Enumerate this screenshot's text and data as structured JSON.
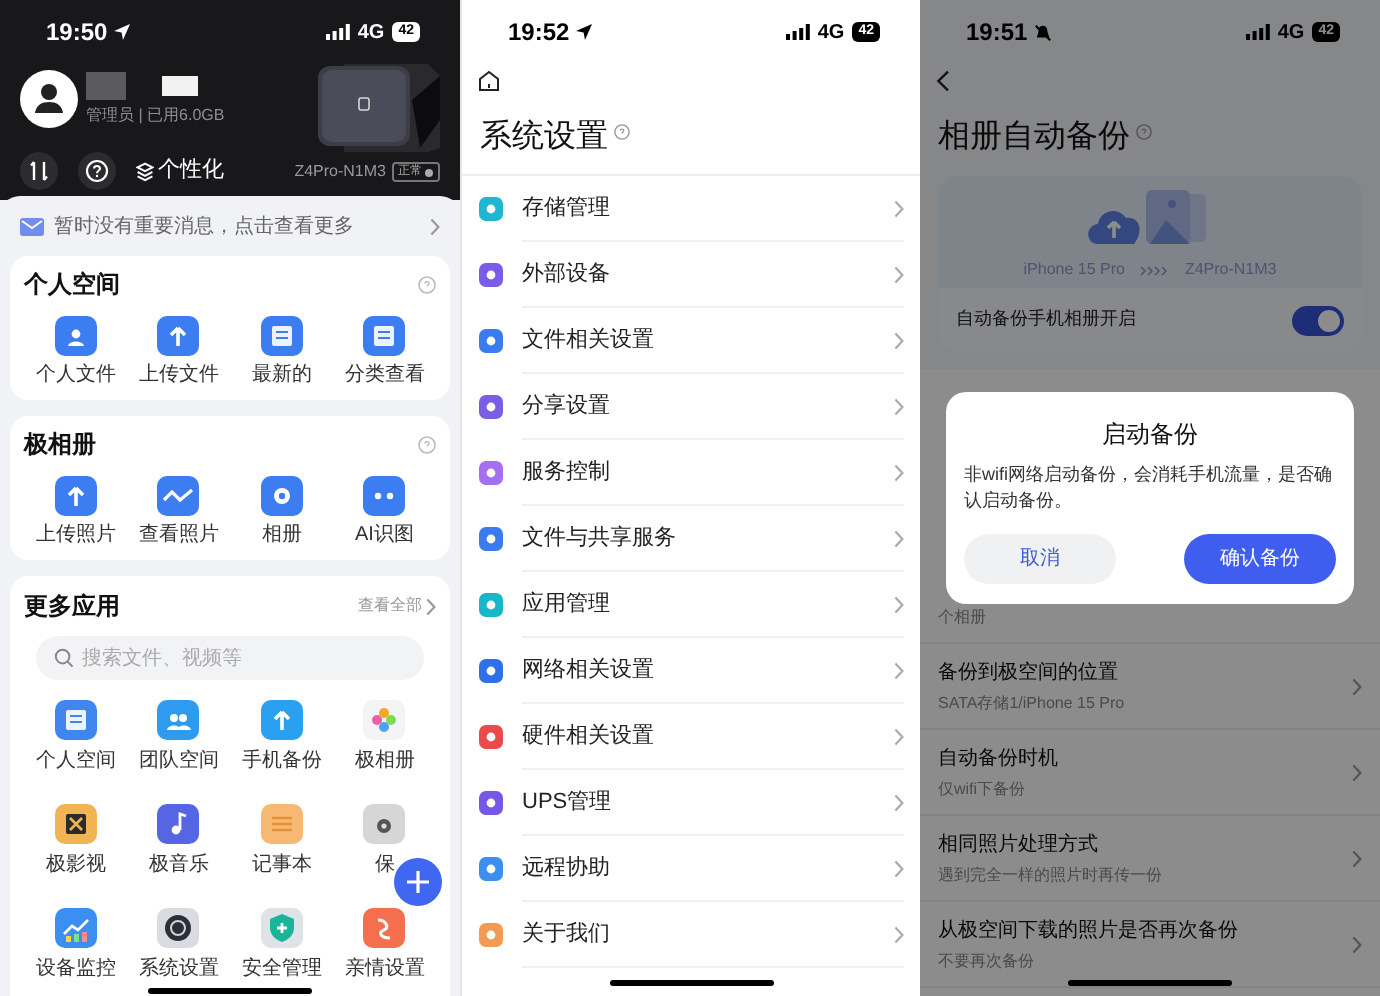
{
  "home_screen": {
    "status_bar": {
      "time": "19:50",
      "network": "4G",
      "battery": "42"
    },
    "profile": {
      "role_usage": "管理员 | 已用6.0GB"
    },
    "toolbar": {
      "personalize": "个性化"
    },
    "device": {
      "name": "Z4Pro-N1M3",
      "status": "正常"
    },
    "notice": "暂时没有重要消息，点击查看更多",
    "sections": [
      {
        "title": "个人空间",
        "items": [
          "个人文件",
          "上传文件",
          "最新的",
          "分类查看"
        ]
      },
      {
        "title": "极相册",
        "items": [
          "上传照片",
          "查看照片",
          "相册",
          "AI识图"
        ]
      }
    ],
    "more_apps": {
      "title": "更多应用",
      "view_all": "查看全部",
      "search_placeholder": "搜索文件、视频等",
      "apps": [
        "个人空间",
        "团队空间",
        "手机备份",
        "极相册",
        "极影视",
        "极音乐",
        "记事本",
        "保",
        "设备监控",
        "系统设置",
        "安全管理",
        "亲情设置"
      ]
    }
  },
  "settings_screen": {
    "status_bar": {
      "time": "19:52",
      "network": "4G",
      "battery": "42"
    },
    "title": "系统设置",
    "items": [
      "存储管理",
      "外部设备",
      "文件相关设置",
      "分享设置",
      "服务控制",
      "文件与共享服务",
      "应用管理",
      "网络相关设置",
      "硬件相关设置",
      "UPS管理",
      "远程协助",
      "关于我们"
    ]
  },
  "backup_screen": {
    "status_bar": {
      "time": "19:51",
      "network": "4G",
      "battery": "42"
    },
    "title": "相册自动备份",
    "source_device": "iPhone 15 Pro",
    "target_device": "Z4Pro-N1M3",
    "auto_backup": {
      "label": "自动备份手机相册开启",
      "on": true
    },
    "covered_note": "个相册",
    "options": [
      {
        "title": "备份到极空间的位置",
        "value": "SATA存储1/iPhone 15 Pro"
      },
      {
        "title": "自动备份时机",
        "value": "仅wifi下备份"
      },
      {
        "title": "相同照片处理方式",
        "value": "遇到完全一样的照片时再传一份"
      },
      {
        "title": "从极空间下载的照片是否再次备份",
        "value": "不要再次备份"
      }
    ],
    "dialog": {
      "title": "启动备份",
      "message": "非wifi网络启动备份，会消耗手机流量，是否确认启动备份。",
      "cancel": "取消",
      "confirm": "确认备份"
    }
  }
}
